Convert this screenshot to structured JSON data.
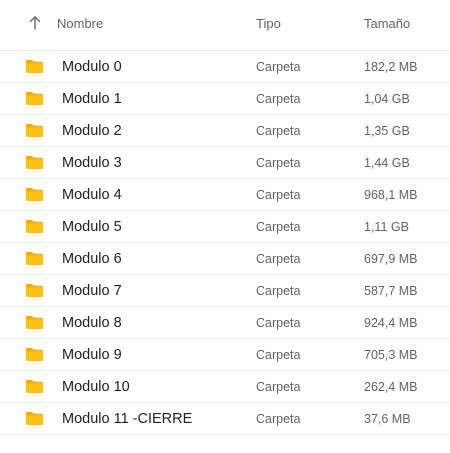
{
  "header": {
    "sort_icon": "arrow-up-icon",
    "name_label": "Nombre",
    "type_label": "Tipo",
    "size_label": "Tamaño"
  },
  "colors": {
    "folder": "#FFC20E",
    "folder_tab": "#F5A800",
    "header_text": "#5f6368",
    "row_border": "#ececec"
  },
  "files": [
    {
      "icon": "folder-icon",
      "name": "Modulo 0",
      "type": "Carpeta",
      "size": "182,2 MB"
    },
    {
      "icon": "folder-icon",
      "name": "Modulo 1",
      "type": "Carpeta",
      "size": "1,04 GB"
    },
    {
      "icon": "folder-icon",
      "name": "Modulo 2",
      "type": "Carpeta",
      "size": "1,35 GB"
    },
    {
      "icon": "folder-icon",
      "name": "Modulo 3",
      "type": "Carpeta",
      "size": "1,44 GB"
    },
    {
      "icon": "folder-icon",
      "name": "Modulo 4",
      "type": "Carpeta",
      "size": "968,1 MB"
    },
    {
      "icon": "folder-icon",
      "name": "Modulo 5",
      "type": "Carpeta",
      "size": "1,11 GB"
    },
    {
      "icon": "folder-icon",
      "name": "Modulo 6",
      "type": "Carpeta",
      "size": "697,9 MB"
    },
    {
      "icon": "folder-icon",
      "name": "Modulo 7",
      "type": "Carpeta",
      "size": "587,7 MB"
    },
    {
      "icon": "folder-icon",
      "name": "Modulo 8",
      "type": "Carpeta",
      "size": "924,4 MB"
    },
    {
      "icon": "folder-icon",
      "name": "Modulo 9",
      "type": "Carpeta",
      "size": "705,3 MB"
    },
    {
      "icon": "folder-icon",
      "name": "Modulo 10",
      "type": "Carpeta",
      "size": "262,4 MB"
    },
    {
      "icon": "folder-icon",
      "name": "Modulo 11 -CIERRE",
      "type": "Carpeta",
      "size": "37,6 MB"
    }
  ]
}
